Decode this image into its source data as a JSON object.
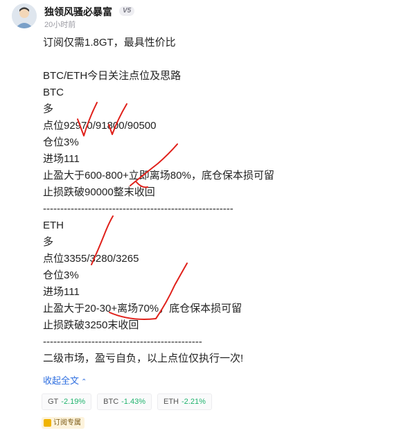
{
  "author": {
    "name": "独领风骚必暴富",
    "badge": "V5",
    "time": "20小时前"
  },
  "post": {
    "lines": [
      "订阅仅需1.8GT，最具性价比",
      "",
      "BTC/ETH今日关注点位及思路",
      "BTC",
      "多",
      "点位92970/91800/90500",
      "仓位3%",
      "进场111",
      "止盈大于600-800+立即离场80%，底仓保本损可留",
      "止损跌破90000整末收回",
      "-------------------------------------------------------",
      "ETH",
      "多",
      "点位3355/3280/3265",
      "仓位3%",
      "进场111",
      "止盈大于20-30+离场70%，底仓保本损可留",
      "止损跌破3250末收回",
      "----------------------------------------------",
      "二级市场，盈亏自负，以上点位仅执行一次!"
    ],
    "collapse_label": "收起全文"
  },
  "tickers": [
    {
      "symbol": "GT",
      "change": "-2.19%"
    },
    {
      "symbol": "BTC",
      "change": "-1.43%"
    },
    {
      "symbol": "ETH",
      "change": "-2.21%"
    }
  ],
  "subscription_badge": "订阅专属",
  "colors": {
    "link": "#2f6fe0",
    "change": "#1fb36d",
    "annotation": "#e0201a"
  }
}
